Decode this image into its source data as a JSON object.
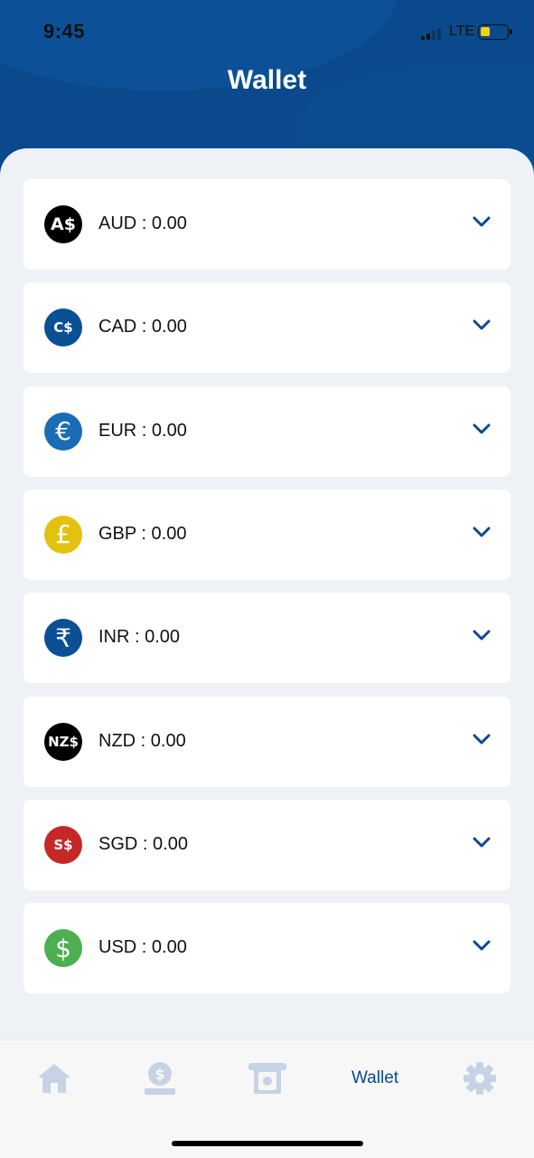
{
  "status_bar": {
    "time": "9:45",
    "network": "LTE",
    "battery_level": 0.35
  },
  "header": {
    "title": "Wallet"
  },
  "wallets": [
    {
      "code": "AUD",
      "symbol": "A$",
      "text": "AUD : 0.00",
      "color": "#000000",
      "size": "normal"
    },
    {
      "code": "CAD",
      "symbol": "C$",
      "text": "CAD : 0.00",
      "color": "#0b4f95",
      "size": "small"
    },
    {
      "code": "EUR",
      "symbol": "€",
      "text": "EUR : 0.00",
      "color": "#1a6cb5",
      "size": "big"
    },
    {
      "code": "GBP",
      "symbol": "£",
      "text": "GBP : 0.00",
      "color": "#e3c10f",
      "size": "big"
    },
    {
      "code": "INR",
      "symbol": "₹",
      "text": "INR : 0.00",
      "color": "#0b4f95",
      "size": "big"
    },
    {
      "code": "NZD",
      "symbol": "NZ$",
      "text": "NZD : 0.00",
      "color": "#000000",
      "size": "normal"
    },
    {
      "code": "SGD",
      "symbol": "S$",
      "text": "SGD : 0.00",
      "color": "#c62828",
      "size": "small"
    },
    {
      "code": "USD",
      "symbol": "$",
      "text": "USD : 0.00",
      "color": "#4caf50",
      "size": "big"
    }
  ],
  "tabbar": {
    "items": [
      {
        "name": "home-tab",
        "icon": "home-icon"
      },
      {
        "name": "deposit-tab",
        "icon": "money-hand-icon"
      },
      {
        "name": "atm-tab",
        "icon": "atm-icon"
      },
      {
        "name": "wallet-tab",
        "label": "Wallet",
        "active": true
      },
      {
        "name": "settings-tab",
        "icon": "gear-icon"
      }
    ]
  },
  "colors": {
    "primary": "#0a4a8c",
    "inactive_icon": "#c5d3e4",
    "background": "#eef2f7"
  }
}
